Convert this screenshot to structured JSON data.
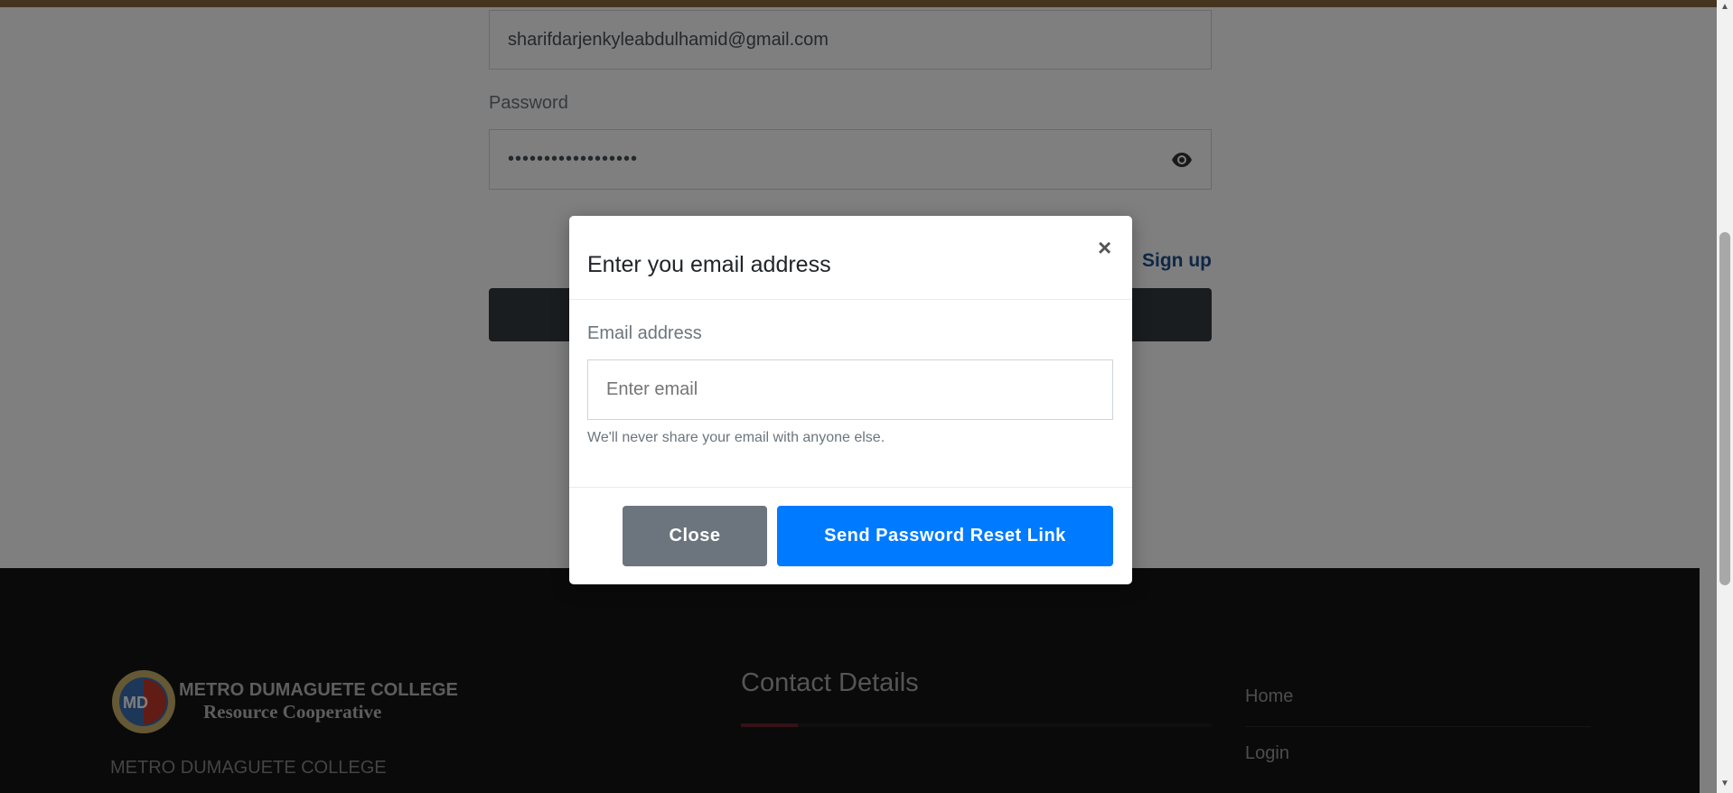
{
  "login": {
    "email_value": "sharifdarjenkyleabdulhamid@gmail.com",
    "password_label": "Password",
    "password_value": "••••••••••••••••••",
    "signup_link": "Sign up"
  },
  "modal": {
    "title": "Enter you email address",
    "close_icon": "×",
    "email_label": "Email address",
    "email_placeholder": "Enter email",
    "help_text": "We'll never share your email with anyone else.",
    "close_button": "Close",
    "send_button": "Send Password Reset Link"
  },
  "footer": {
    "logo_line1": "METRO DUMAGUETE COLLEGE",
    "logo_line2": "Resource Cooperative",
    "college_name": "METRO DUMAGUETE COLLEGE",
    "contact_title": "Contact Details",
    "links": [
      "Home",
      "Login"
    ]
  },
  "colors": {
    "primary": "#007bff",
    "secondary": "#6c757d",
    "accent_brown": "#8a6a3e",
    "link": "#1c4f8c",
    "dark_button": "#343a40"
  }
}
